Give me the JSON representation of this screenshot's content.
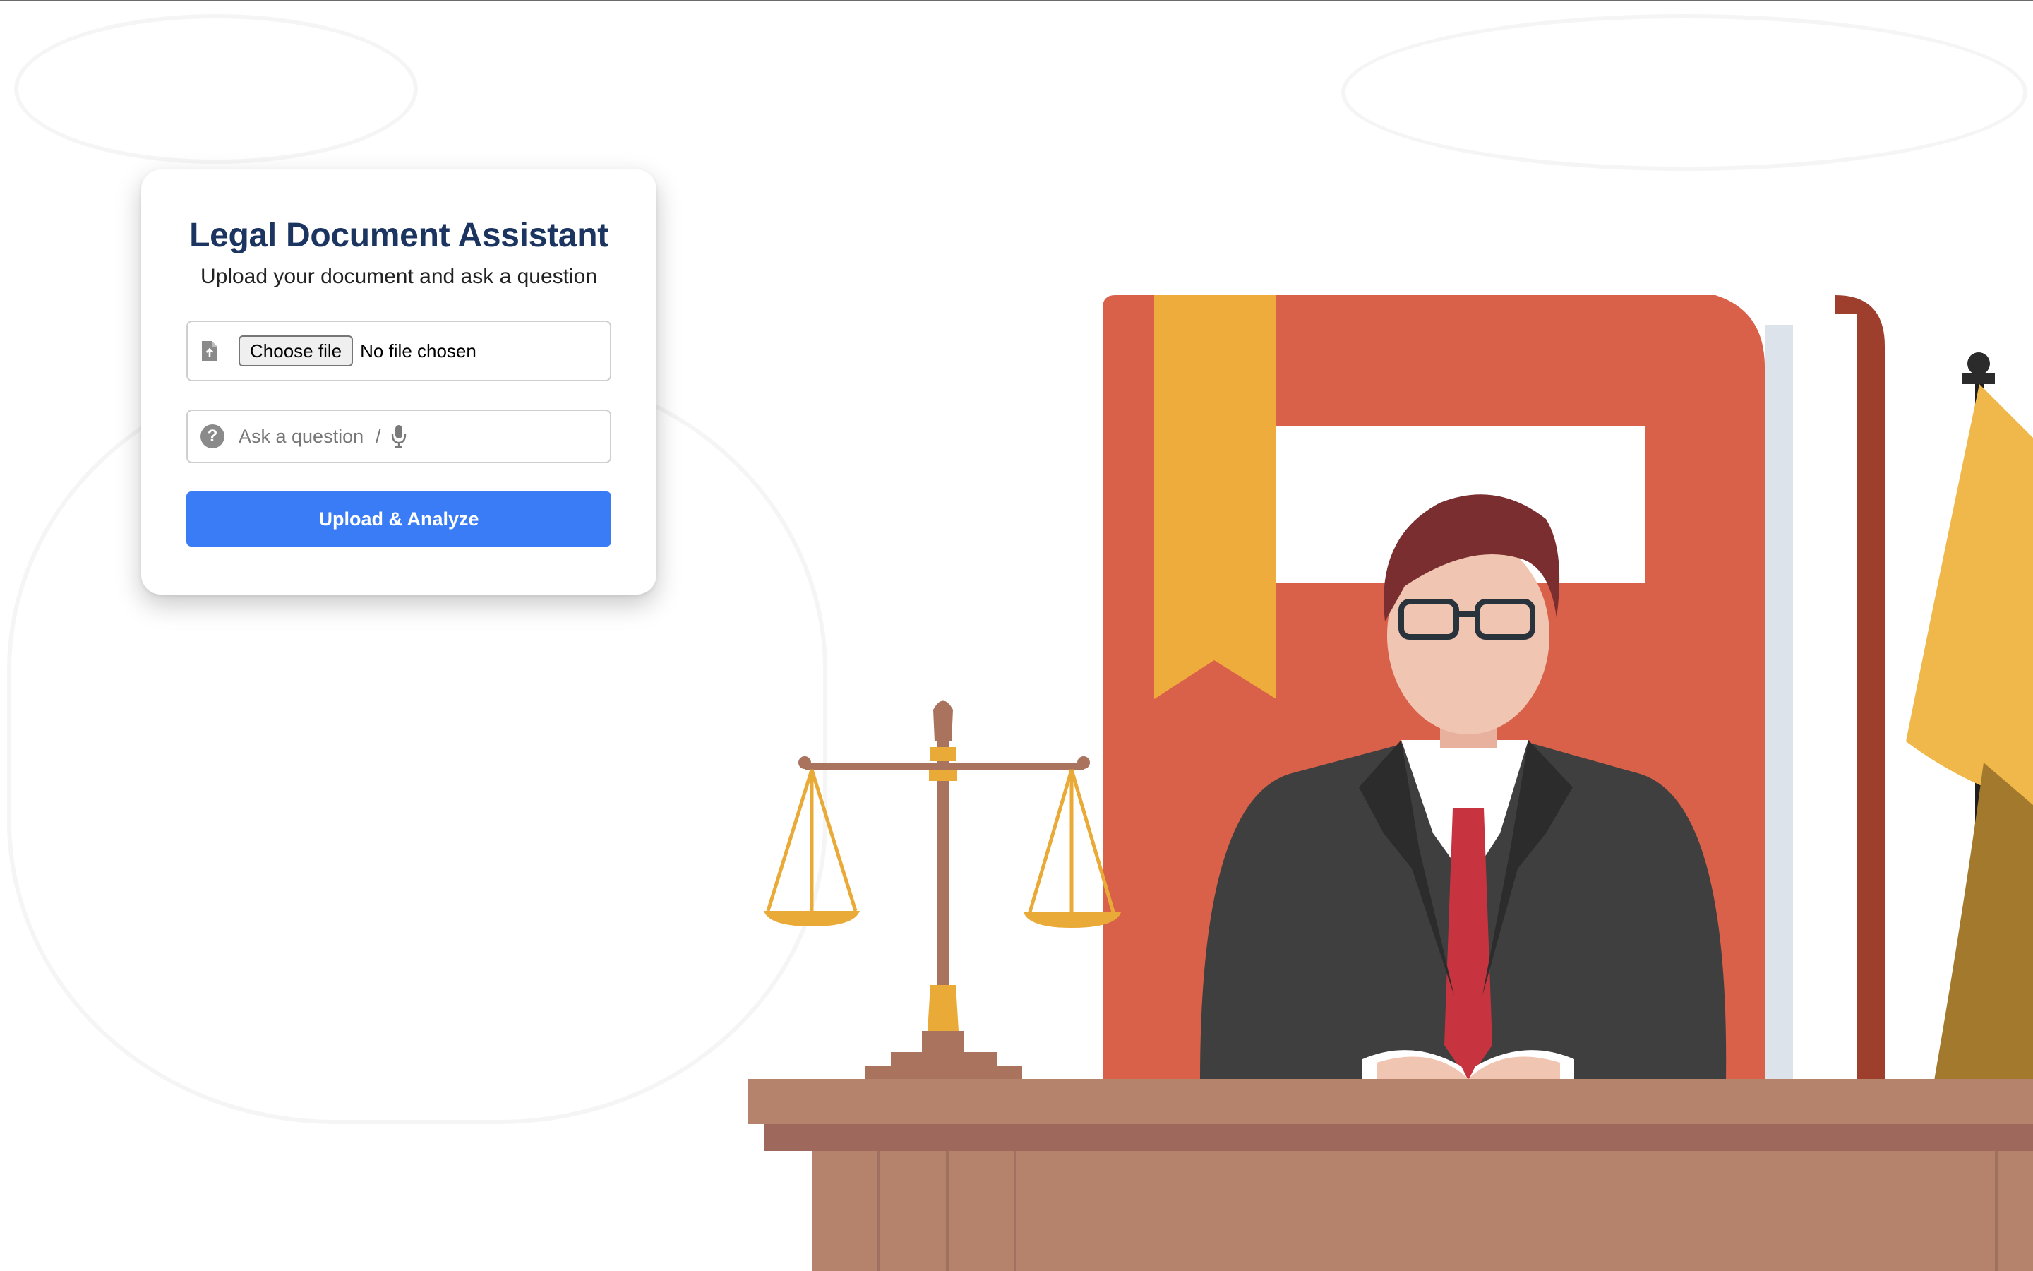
{
  "card": {
    "title": "Legal Document Assistant",
    "subtitle": "Upload your document and ask a question",
    "file_input": {
      "button_label": "Choose file",
      "status": "No file chosen",
      "icon": "file-upload-icon"
    },
    "question_input": {
      "placeholder": "Ask a question",
      "separator": "/",
      "icon": "question-icon",
      "mic_icon": "microphone-icon"
    },
    "submit_label": "Upload & Analyze"
  },
  "colors": {
    "title": "#1b3560",
    "button": "#3a7cf5",
    "book": "#d9614a",
    "bookmark": "#eeac3c",
    "desk": "#b5836c",
    "suit": "#3f3f3f",
    "tie": "#c73440"
  },
  "illustration": {
    "subject": "judge at desk",
    "elements": [
      "scales-of-justice",
      "red-law-book",
      "bookmark",
      "judge",
      "flag",
      "desk"
    ]
  }
}
